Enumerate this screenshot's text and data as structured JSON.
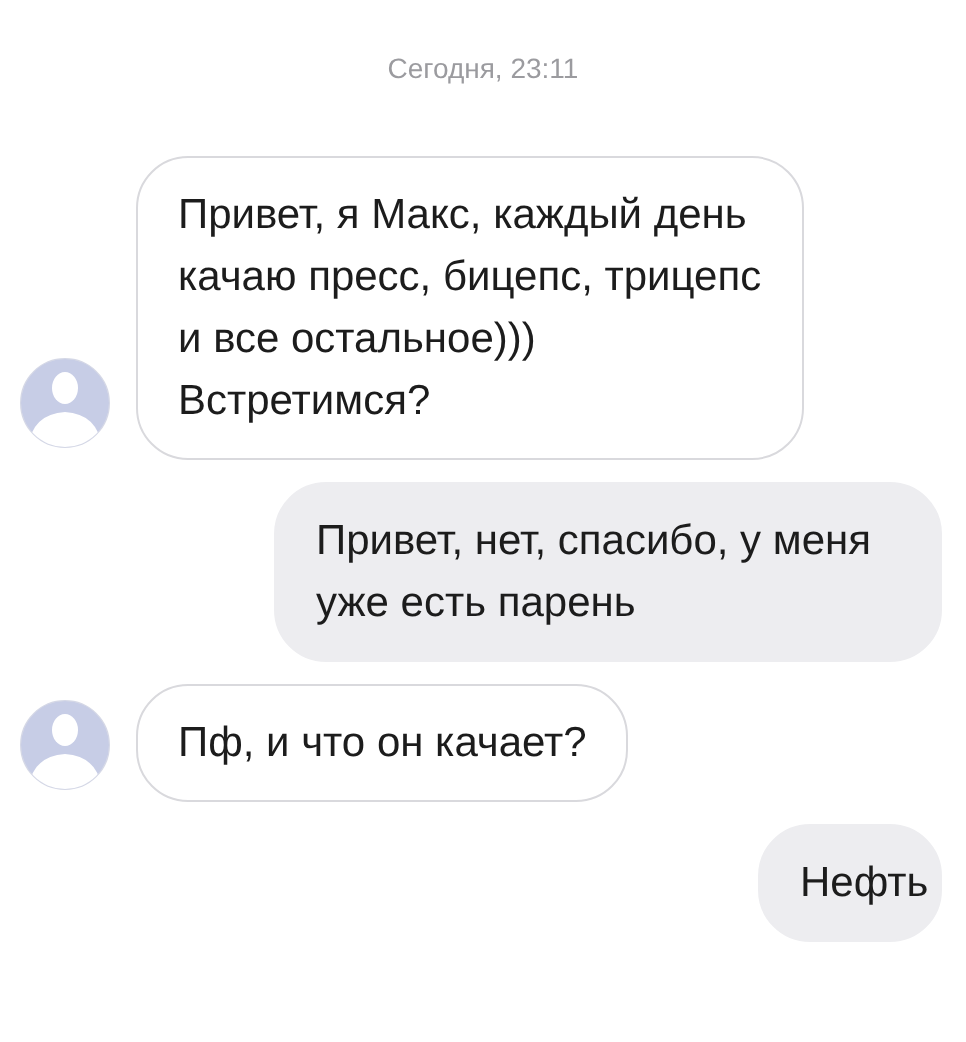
{
  "date_label": "Сегодня, 23:11",
  "messages": [
    {
      "kind": "incoming",
      "text": "Привет, я Макс, каждый день качаю пресс, бицепс, трицепс и все остальное))) Встретимся?"
    },
    {
      "kind": "outgoing",
      "text": "Привет, нет, спасибо, у меня уже есть парень"
    },
    {
      "kind": "incoming",
      "text": "Пф, и что он качает?"
    },
    {
      "kind": "outgoing",
      "text": "Нефть"
    }
  ]
}
